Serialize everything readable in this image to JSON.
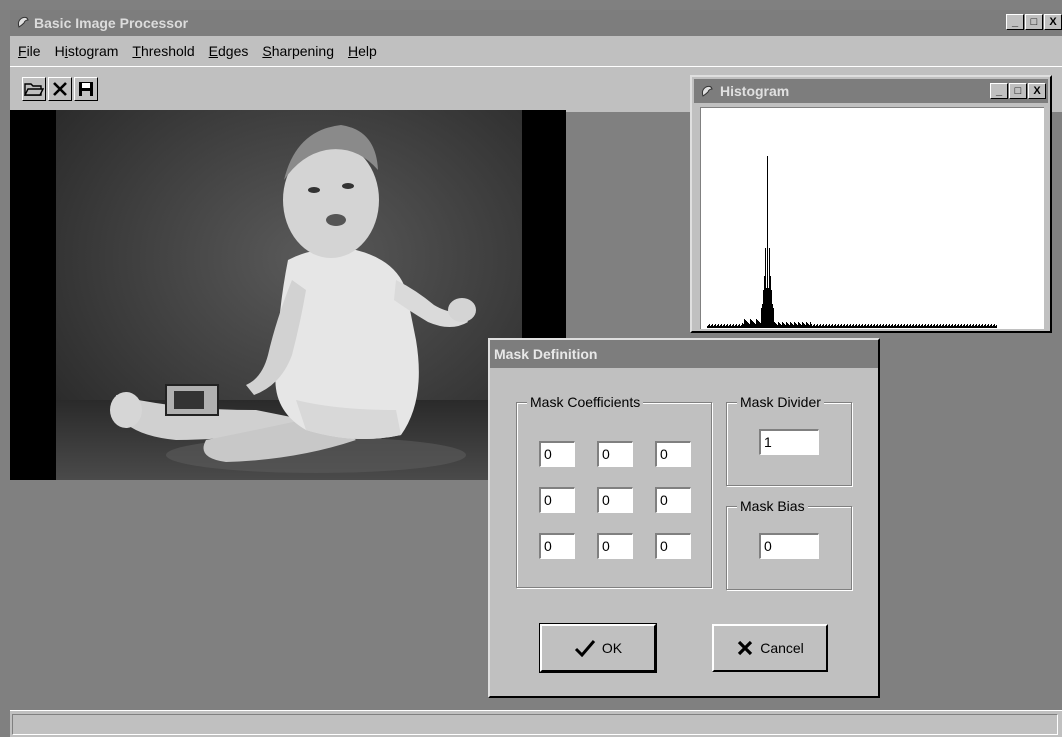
{
  "app": {
    "title": "Basic Image Processor",
    "window_buttons": [
      "_",
      "□",
      "X"
    ]
  },
  "menu": {
    "items": [
      {
        "pre": "",
        "key": "F",
        "post": "ile"
      },
      {
        "pre": "H",
        "key": "i",
        "post": "stogram"
      },
      {
        "pre": "",
        "key": "T",
        "post": "hreshold"
      },
      {
        "pre": "",
        "key": "E",
        "post": "dges"
      },
      {
        "pre": "",
        "key": "S",
        "post": "harpening"
      },
      {
        "pre": "",
        "key": "H",
        "post": "elp"
      }
    ]
  },
  "toolbar": {
    "buttons": [
      "open-folder-icon",
      "close-x-icon",
      "save-disk-icon"
    ]
  },
  "histogram_window": {
    "title": "Histogram",
    "window_buttons": [
      "_",
      "□",
      "X"
    ]
  },
  "mask_dialog": {
    "title": "Mask Definition",
    "coefficients_label": "Mask Coefficients",
    "coefficients": [
      [
        "0",
        "0",
        "0"
      ],
      [
        "0",
        "0",
        "0"
      ],
      [
        "0",
        "0",
        "0"
      ]
    ],
    "divider_label": "Mask Divider",
    "divider_value": "1",
    "bias_label": "Mask Bias",
    "bias_value": "0",
    "ok_label": "OK",
    "cancel_label": "Cancel"
  },
  "colors": {
    "titlebar": "#7d7d7d",
    "face": "#c0c0c0",
    "workspace": "#808080"
  }
}
